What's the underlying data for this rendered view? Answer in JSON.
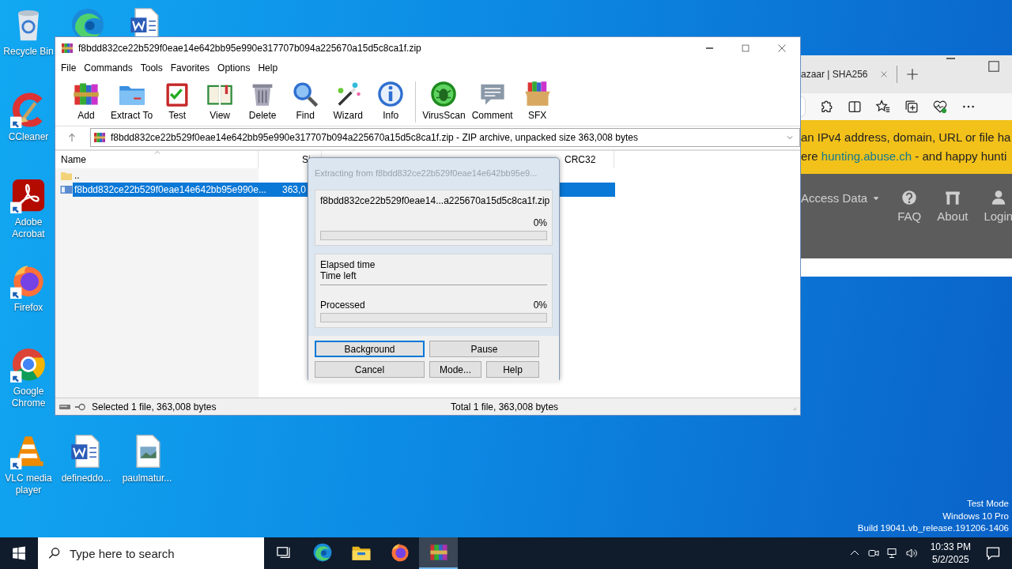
{
  "desktop": {
    "icons": [
      {
        "kind": "recycle",
        "label": "Recycle Bin",
        "shortcut": false
      },
      {
        "kind": "edge",
        "shortcut": false
      },
      {
        "kind": "word",
        "shortcut": false
      },
      {
        "kind": "ccleaner",
        "label": "CCleaner",
        "shortcut": true
      },
      {
        "kind": "acrobat",
        "label": "Adobe Acrobat",
        "shortcut": true
      },
      {
        "kind": "firefox",
        "label": "Firefox",
        "shortcut": true
      },
      {
        "kind": "chrome",
        "label": "Google Chrome",
        "shortcut": true
      },
      {
        "kind": "vlc",
        "label": "VLC media player",
        "shortcut": true
      },
      {
        "kind": "word",
        "label": "defineddo...",
        "shortcut": false
      },
      {
        "kind": "image",
        "label": "paulmatur...",
        "shortcut": false
      }
    ],
    "system_text": [
      "Test Mode",
      "Windows 10 Pro",
      "Build 19041.vb_release.191206-1406"
    ]
  },
  "browser": {
    "tab_title": "azaar | SHA256",
    "banner_line_1": "an IPv4 address, domain, URL or file ha",
    "banner_line_2": {
      "before": "ere ",
      "link": "hunting.abuse.ch",
      "after": " - and happy hunti"
    },
    "nav": [
      {
        "kind": "dropdown",
        "label": "Access Data"
      },
      {
        "kind": "question",
        "label": "FAQ"
      },
      {
        "kind": "building",
        "label": "About"
      },
      {
        "kind": "person",
        "label": "Login"
      }
    ]
  },
  "winrar": {
    "title": "f8bdd832ce22b529f0eae14e642bb95e990e317707b094a225670a15d5c8ca1f.zip",
    "menu": [
      "File",
      "Commands",
      "Tools",
      "Favorites",
      "Options",
      "Help"
    ],
    "toolbar": [
      {
        "kind": "books",
        "label": "Add"
      },
      {
        "kind": "folder",
        "label": "Extract To"
      },
      {
        "kind": "clipboard",
        "label": "Test"
      },
      {
        "kind": "book",
        "label": "View"
      },
      {
        "kind": "trash",
        "label": "Delete"
      },
      {
        "kind": "magnifier",
        "label": "Find"
      },
      {
        "kind": "wand",
        "label": "Wizard"
      },
      {
        "kind": "info",
        "label": "Info"
      },
      {
        "kind": "bug",
        "label": "VirusScan"
      },
      {
        "kind": "comment",
        "label": "Comment"
      },
      {
        "kind": "box",
        "label": "SFX"
      }
    ],
    "address": "f8bdd832ce22b529f0eae14e642bb95e990e317707b094a225670a15d5c8ca1f.zip - ZIP archive, unpacked size 363,008 bytes",
    "columns": [
      "Name",
      "Si",
      "CRC32"
    ],
    "rows": [
      {
        "kind": "folder",
        "name": "..",
        "selected": false
      },
      {
        "kind": "archive",
        "name": "f8bdd832ce22b529f0eae14e642bb95e990e...",
        "size": "363,0",
        "selected": true
      }
    ],
    "status_left": "Selected 1 file, 363,008 bytes",
    "status_right": "Total 1 file, 363,008 bytes"
  },
  "dialog": {
    "title": "Extracting from f8bdd832ce22b529f0eae14e642bb95e9...",
    "file": "f8bdd832ce22b529f0eae14...a225670a15d5c8ca1f.zip",
    "file_percent": "0%",
    "file_progress": {
      "level": 0
    },
    "time_labels": [
      "Elapsed time",
      "Time left"
    ],
    "processed_label": "Processed",
    "processed_percent": "0%",
    "processed_progress": {
      "level": 0
    },
    "buttons": [
      {
        "label": "Background",
        "focused": true
      },
      {
        "label": "Pause",
        "focused": false
      },
      {
        "label": "Cancel",
        "focused": false
      },
      {
        "label": "Mode...",
        "focused": false
      },
      {
        "label": "Help",
        "focused": false
      }
    ]
  },
  "taskbar": {
    "search_placeholder": "Type here to search",
    "apps": [
      {
        "kind": "taskview",
        "active": false
      },
      {
        "kind": "edge",
        "active": false
      },
      {
        "kind": "explorer",
        "active": false
      },
      {
        "kind": "firefox",
        "active": false
      },
      {
        "kind": "winrar",
        "active": true
      }
    ],
    "time": "10:33 PM",
    "date": "5/2/2025"
  }
}
